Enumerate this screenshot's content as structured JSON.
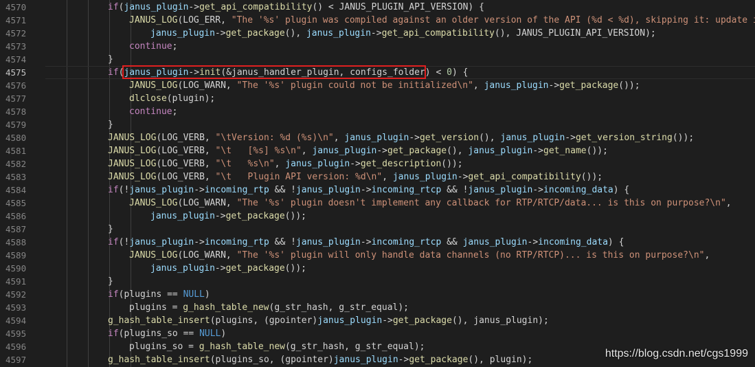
{
  "editor": {
    "current_line": "4575",
    "lines": [
      {
        "num": "4570",
        "indent": 2,
        "tokens": [
          [
            "kw",
            "if"
          ],
          [
            "op",
            "("
          ],
          [
            "id",
            "janus_plugin"
          ],
          [
            "op",
            "->"
          ],
          [
            "fn",
            "get_api_compatibility"
          ],
          [
            "op",
            "() < JANUS_PLUGIN_API_VERSION) {"
          ]
        ]
      },
      {
        "num": "4571",
        "indent": 3,
        "tokens": [
          [
            "fn",
            "JANUS_LOG"
          ],
          [
            "op",
            "(LOG_ERR, "
          ],
          [
            "str",
            "\"The '%s' plugin was compiled against an older version of the API (%d < %d), skipping it: update it"
          ]
        ]
      },
      {
        "num": "4572",
        "indent": 4,
        "tokens": [
          [
            "id",
            "janus_plugin"
          ],
          [
            "op",
            "->"
          ],
          [
            "fn",
            "get_package"
          ],
          [
            "op",
            "(), "
          ],
          [
            "id",
            "janus_plugin"
          ],
          [
            "op",
            "->"
          ],
          [
            "fn",
            "get_api_compatibility"
          ],
          [
            "op",
            "(), JANUS_PLUGIN_API_VERSION);"
          ]
        ]
      },
      {
        "num": "4573",
        "indent": 3,
        "tokens": [
          [
            "kw",
            "continue"
          ],
          [
            "op",
            ";"
          ]
        ]
      },
      {
        "num": "4574",
        "indent": 2,
        "tokens": [
          [
            "op",
            "}"
          ]
        ]
      },
      {
        "num": "4575",
        "indent": 2,
        "tokens": [
          [
            "kw",
            "if"
          ],
          [
            "op",
            "("
          ],
          [
            "id",
            "janus_plugin"
          ],
          [
            "op",
            "->"
          ],
          [
            "fn",
            "init"
          ],
          [
            "op",
            "(&janus_handler_plugin, configs_folder) < "
          ],
          [
            "num",
            "0"
          ],
          [
            "op",
            ") {"
          ]
        ]
      },
      {
        "num": "4576",
        "indent": 3,
        "tokens": [
          [
            "fn",
            "JANUS_LOG"
          ],
          [
            "op",
            "(LOG_WARN, "
          ],
          [
            "str",
            "\"The '%s' plugin could not be initialized\\n\""
          ],
          [
            "op",
            ", "
          ],
          [
            "id",
            "janus_plugin"
          ],
          [
            "op",
            "->"
          ],
          [
            "fn",
            "get_package"
          ],
          [
            "op",
            "());"
          ]
        ]
      },
      {
        "num": "4577",
        "indent": 3,
        "tokens": [
          [
            "fn",
            "dlclose"
          ],
          [
            "op",
            "(plugin);"
          ]
        ]
      },
      {
        "num": "4578",
        "indent": 3,
        "tokens": [
          [
            "kw",
            "continue"
          ],
          [
            "op",
            ";"
          ]
        ]
      },
      {
        "num": "4579",
        "indent": 2,
        "tokens": [
          [
            "op",
            "}"
          ]
        ]
      },
      {
        "num": "4580",
        "indent": 2,
        "tokens": [
          [
            "fn",
            "JANUS_LOG"
          ],
          [
            "op",
            "(LOG_VERB, "
          ],
          [
            "str",
            "\"\\tVersion: %d (%s)\\n\""
          ],
          [
            "op",
            ", "
          ],
          [
            "id",
            "janus_plugin"
          ],
          [
            "op",
            "->"
          ],
          [
            "fn",
            "get_version"
          ],
          [
            "op",
            "(), "
          ],
          [
            "id",
            "janus_plugin"
          ],
          [
            "op",
            "->"
          ],
          [
            "fn",
            "get_version_string"
          ],
          [
            "op",
            "());"
          ]
        ]
      },
      {
        "num": "4581",
        "indent": 2,
        "tokens": [
          [
            "fn",
            "JANUS_LOG"
          ],
          [
            "op",
            "(LOG_VERB, "
          ],
          [
            "str",
            "\"\\t   [%s] %s\\n\""
          ],
          [
            "op",
            ", "
          ],
          [
            "id",
            "janus_plugin"
          ],
          [
            "op",
            "->"
          ],
          [
            "fn",
            "get_package"
          ],
          [
            "op",
            "(), "
          ],
          [
            "id",
            "janus_plugin"
          ],
          [
            "op",
            "->"
          ],
          [
            "fn",
            "get_name"
          ],
          [
            "op",
            "());"
          ]
        ]
      },
      {
        "num": "4582",
        "indent": 2,
        "tokens": [
          [
            "fn",
            "JANUS_LOG"
          ],
          [
            "op",
            "(LOG_VERB, "
          ],
          [
            "str",
            "\"\\t   %s\\n\""
          ],
          [
            "op",
            ", "
          ],
          [
            "id",
            "janus_plugin"
          ],
          [
            "op",
            "->"
          ],
          [
            "fn",
            "get_description"
          ],
          [
            "op",
            "());"
          ]
        ]
      },
      {
        "num": "4583",
        "indent": 2,
        "tokens": [
          [
            "fn",
            "JANUS_LOG"
          ],
          [
            "op",
            "(LOG_VERB, "
          ],
          [
            "str",
            "\"\\t   Plugin API version: %d\\n\""
          ],
          [
            "op",
            ", "
          ],
          [
            "id",
            "janus_plugin"
          ],
          [
            "op",
            "->"
          ],
          [
            "fn",
            "get_api_compatibility"
          ],
          [
            "op",
            "());"
          ]
        ]
      },
      {
        "num": "4584",
        "indent": 2,
        "tokens": [
          [
            "kw",
            "if"
          ],
          [
            "op",
            "(!"
          ],
          [
            "id",
            "janus_plugin"
          ],
          [
            "op",
            "->"
          ],
          [
            "id",
            "incoming_rtp"
          ],
          [
            "op",
            " && !"
          ],
          [
            "id",
            "janus_plugin"
          ],
          [
            "op",
            "->"
          ],
          [
            "id",
            "incoming_rtcp"
          ],
          [
            "op",
            " && !"
          ],
          [
            "id",
            "janus_plugin"
          ],
          [
            "op",
            "->"
          ],
          [
            "id",
            "incoming_data"
          ],
          [
            "op",
            ") {"
          ]
        ]
      },
      {
        "num": "4585",
        "indent": 3,
        "tokens": [
          [
            "fn",
            "JANUS_LOG"
          ],
          [
            "op",
            "(LOG_WARN, "
          ],
          [
            "str",
            "\"The '%s' plugin doesn't implement any callback for RTP/RTCP/data... is this on purpose?\\n\""
          ],
          [
            "op",
            ","
          ]
        ]
      },
      {
        "num": "4586",
        "indent": 4,
        "tokens": [
          [
            "id",
            "janus_plugin"
          ],
          [
            "op",
            "->"
          ],
          [
            "fn",
            "get_package"
          ],
          [
            "op",
            "());"
          ]
        ]
      },
      {
        "num": "4587",
        "indent": 2,
        "tokens": [
          [
            "op",
            "}"
          ]
        ]
      },
      {
        "num": "4588",
        "indent": 2,
        "tokens": [
          [
            "kw",
            "if"
          ],
          [
            "op",
            "(!"
          ],
          [
            "id",
            "janus_plugin"
          ],
          [
            "op",
            "->"
          ],
          [
            "id",
            "incoming_rtp"
          ],
          [
            "op",
            " && !"
          ],
          [
            "id",
            "janus_plugin"
          ],
          [
            "op",
            "->"
          ],
          [
            "id",
            "incoming_rtcp"
          ],
          [
            "op",
            " && "
          ],
          [
            "id",
            "janus_plugin"
          ],
          [
            "op",
            "->"
          ],
          [
            "id",
            "incoming_data"
          ],
          [
            "op",
            ") {"
          ]
        ]
      },
      {
        "num": "4589",
        "indent": 3,
        "tokens": [
          [
            "fn",
            "JANUS_LOG"
          ],
          [
            "op",
            "(LOG_WARN, "
          ],
          [
            "str",
            "\"The '%s' plugin will only handle data channels (no RTP/RTCP)... is this on purpose?\\n\""
          ],
          [
            "op",
            ","
          ]
        ]
      },
      {
        "num": "4590",
        "indent": 4,
        "tokens": [
          [
            "id",
            "janus_plugin"
          ],
          [
            "op",
            "->"
          ],
          [
            "fn",
            "get_package"
          ],
          [
            "op",
            "());"
          ]
        ]
      },
      {
        "num": "4591",
        "indent": 2,
        "tokens": [
          [
            "op",
            "}"
          ]
        ]
      },
      {
        "num": "4592",
        "indent": 2,
        "tokens": [
          [
            "kw",
            "if"
          ],
          [
            "op",
            "(plugins == "
          ],
          [
            "const",
            "NULL"
          ],
          [
            "op",
            ")"
          ]
        ]
      },
      {
        "num": "4593",
        "indent": 3,
        "tokens": [
          [
            "op",
            "plugins = "
          ],
          [
            "fn",
            "g_hash_table_new"
          ],
          [
            "op",
            "(g_str_hash, g_str_equal);"
          ]
        ]
      },
      {
        "num": "4594",
        "indent": 2,
        "tokens": [
          [
            "fn",
            "g_hash_table_insert"
          ],
          [
            "op",
            "(plugins, (gpointer)"
          ],
          [
            "id",
            "janus_plugin"
          ],
          [
            "op",
            "->"
          ],
          [
            "fn",
            "get_package"
          ],
          [
            "op",
            "(), janus_plugin);"
          ]
        ]
      },
      {
        "num": "4595",
        "indent": 2,
        "tokens": [
          [
            "kw",
            "if"
          ],
          [
            "op",
            "(plugins_so == "
          ],
          [
            "const",
            "NULL"
          ],
          [
            "op",
            ")"
          ]
        ]
      },
      {
        "num": "4596",
        "indent": 3,
        "tokens": [
          [
            "op",
            "plugins_so = "
          ],
          [
            "fn",
            "g_hash_table_new"
          ],
          [
            "op",
            "(g_str_hash, g_str_equal);"
          ]
        ]
      },
      {
        "num": "4597",
        "indent": 2,
        "tokens": [
          [
            "fn",
            "g_hash_table_insert"
          ],
          [
            "op",
            "(plugins_so, (gpointer)"
          ],
          [
            "id",
            "janus_plugin"
          ],
          [
            "op",
            "->"
          ],
          [
            "fn",
            "get_package"
          ],
          [
            "op",
            "(), plugin);"
          ]
        ]
      }
    ]
  },
  "watermark": {
    "text": "https://blog.csdn.net/cgs1999"
  },
  "colors": {
    "background": "#1e1e1e",
    "line_number": "#858585",
    "keyword": "#c586c0",
    "identifier": "#9cdcfe",
    "function": "#dcdcaa",
    "string": "#ce9178",
    "number": "#b5cea8",
    "constant": "#569cd6",
    "highlight_box": "#e02020"
  }
}
